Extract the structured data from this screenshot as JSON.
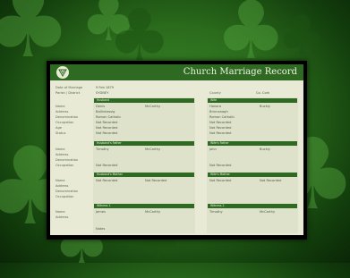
{
  "record": {
    "title": "Church Marriage Record",
    "date_label": "Date of Marriage",
    "date_value": "9 Feb 1879",
    "parish_label": "Parish / District",
    "parish_value": "SYDNEY",
    "county_label": "County",
    "county_value": "Co. Cork"
  },
  "groom": {
    "header": "Husband",
    "labels": [
      "Name",
      "Address",
      "Denomination",
      "Occupation",
      "Age",
      "Status"
    ],
    "first_name": "Denis",
    "last_name": "McCarthy",
    "values": [
      "Ballinhassig",
      "Roman Catholic",
      "Not Recorded",
      "Not Recorded",
      "Not Recorded"
    ]
  },
  "bride": {
    "header": "Wife",
    "first_name": "Hanora",
    "last_name": "Buckly",
    "values": [
      "Brinnanagh",
      "Roman Catholic",
      "Not Recorded",
      "Not Recorded",
      "Not Recorded"
    ]
  },
  "groom_father": {
    "header": "Husband's Father",
    "labels": [
      "Name",
      "Address",
      "Denomination",
      "Occupation"
    ],
    "first_name": "Timothy",
    "last_name": "McCarthy",
    "occupation": "Not Recorded"
  },
  "bride_father": {
    "header": "Wife's Father",
    "first_name": "John",
    "last_name": "Buckly",
    "occupation": "Not Recorded"
  },
  "groom_mother": {
    "header": "Husband's Mother",
    "labels": [
      "Name",
      "Address",
      "Denomination",
      "Occupation"
    ],
    "first_name": "Not Recorded",
    "last_name": "Not Recorded"
  },
  "bride_mother": {
    "header": "Wife's Mother",
    "first_name": "Not Recorded",
    "last_name": "Not Recorded"
  },
  "witness1": {
    "header": "Witness 1",
    "labels": [
      "Name",
      "Address"
    ],
    "first_name": "James",
    "last_name": "McCarthy"
  },
  "witness2": {
    "header": "Witness 2",
    "first_name": "Timothy",
    "last_name": "McCarthy"
  },
  "notes_label": "Notes"
}
